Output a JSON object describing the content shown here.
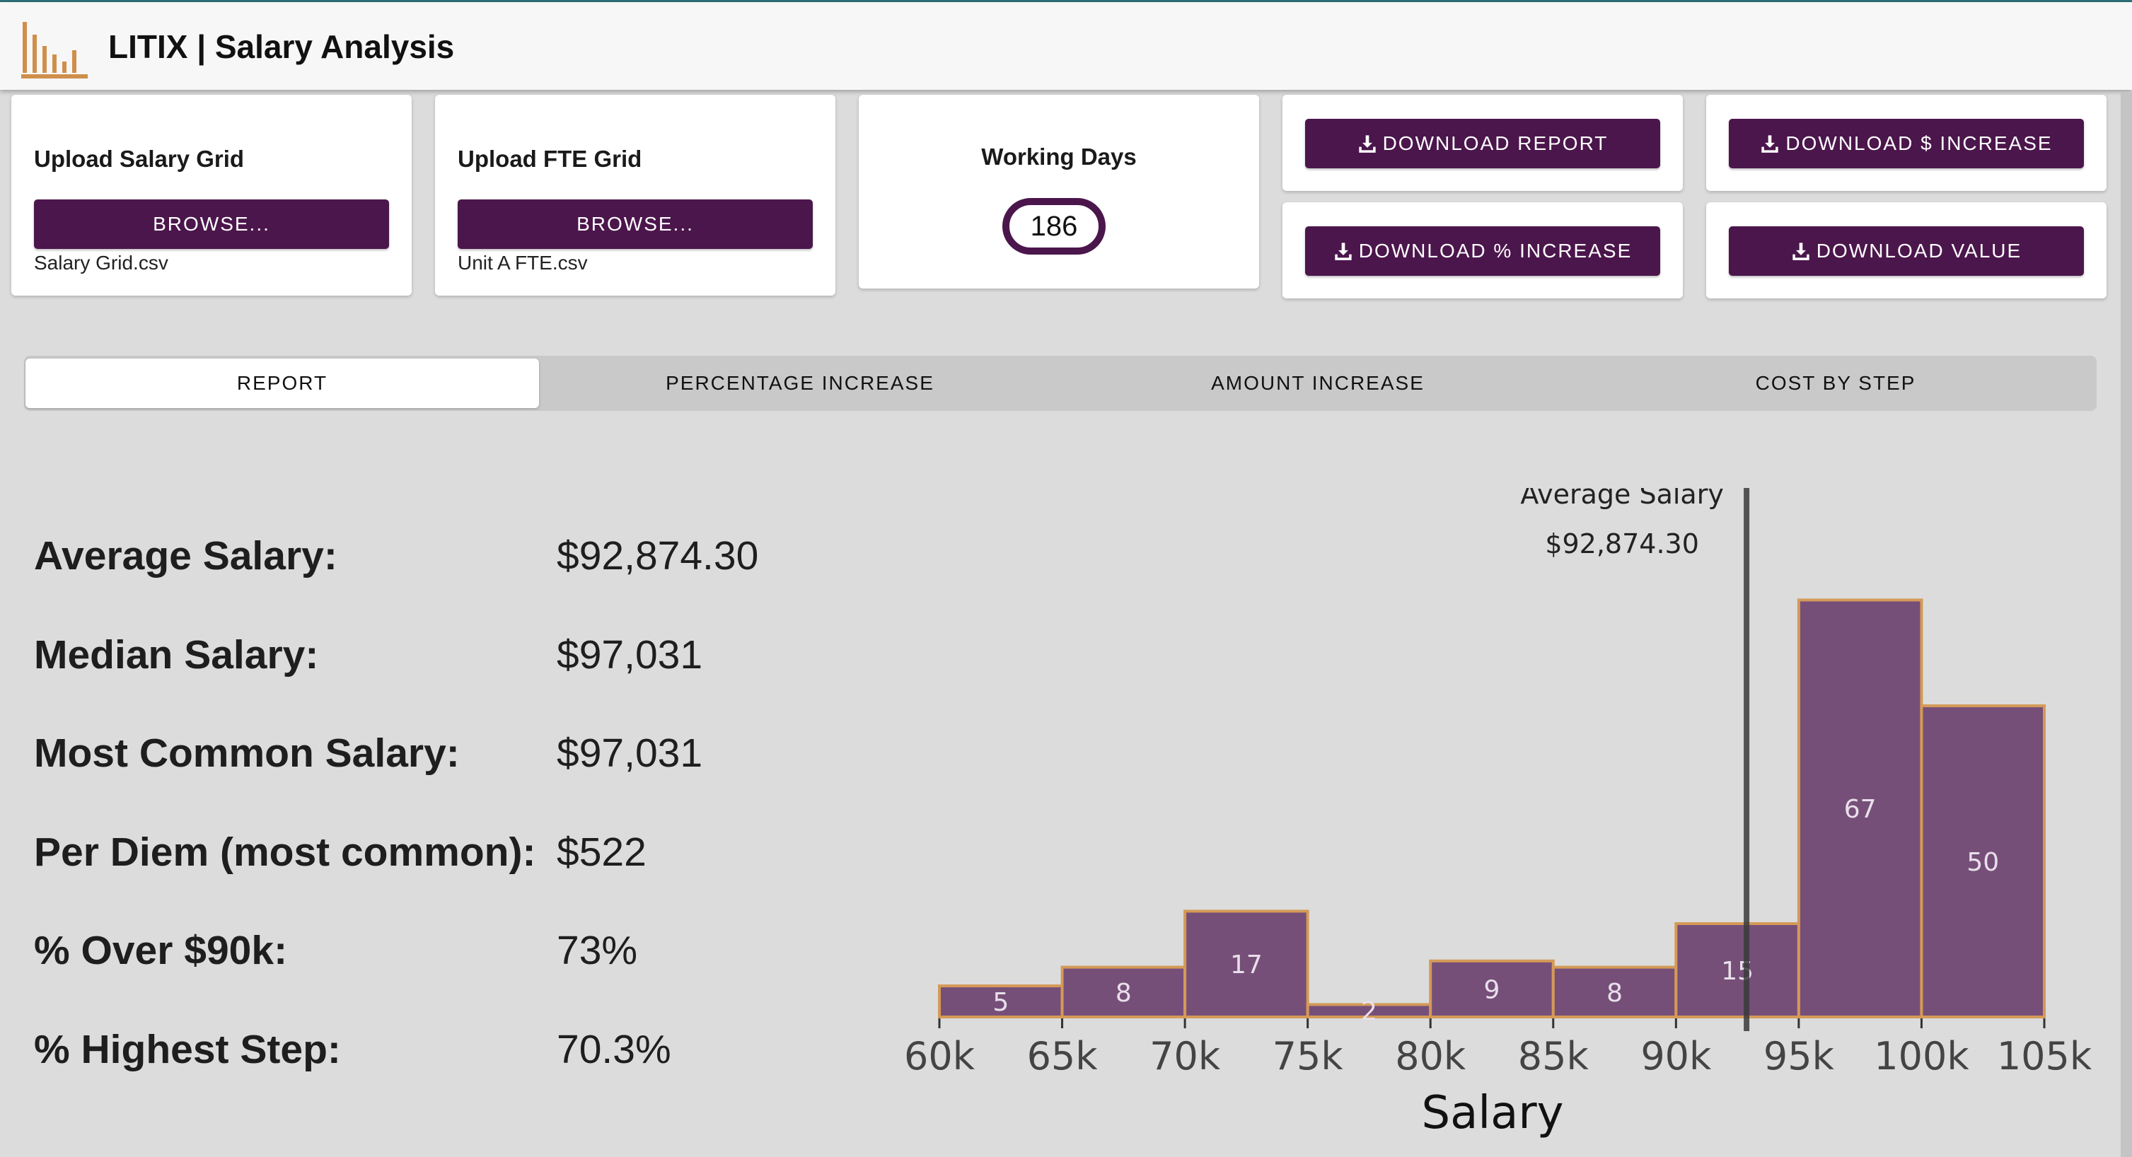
{
  "header": {
    "title": "LITIX | Salary Analysis",
    "logo_icon": "bar-chart-logo-icon"
  },
  "uploads": [
    {
      "title": "Upload Salary Grid",
      "button": "BROWSE...",
      "filename": "Salary Grid.csv"
    },
    {
      "title": "Upload FTE Grid",
      "button": "BROWSE...",
      "filename": "Unit A FTE.csv"
    }
  ],
  "working_days": {
    "title": "Working Days",
    "value": "186"
  },
  "downloads": {
    "report": "DOWNLOAD REPORT",
    "dollar_increase": "DOWNLOAD $ INCREASE",
    "percent_increase": "DOWNLOAD % INCREASE",
    "value": "DOWNLOAD VALUE",
    "icon": "download-icon"
  },
  "tabs": [
    {
      "label": "REPORT",
      "active": true
    },
    {
      "label": "PERCENTAGE INCREASE",
      "active": false
    },
    {
      "label": "AMOUNT INCREASE",
      "active": false
    },
    {
      "label": "COST BY STEP",
      "active": false
    }
  ],
  "stats": [
    {
      "label": "Average Salary:",
      "value": "$92,874.30"
    },
    {
      "label": "Median Salary:",
      "value": "$97,031"
    },
    {
      "label": "Most Common Salary:",
      "value": "$97,031"
    },
    {
      "label": "Per Diem (most common):",
      "value": "$522"
    },
    {
      "label": "% Over $90k:",
      "value": "73%"
    },
    {
      "label": "% Highest Step:",
      "value": "70.3%"
    }
  ],
  "colors": {
    "accent": "#4b164c",
    "bar_fill": "#764f79",
    "bar_edge": "#d49a57",
    "logo": "#cf8f4b"
  },
  "chart_data": {
    "type": "bar",
    "xlabel": "Salary",
    "ylabel": "",
    "bin_edges": [
      60000,
      65000,
      70000,
      75000,
      80000,
      85000,
      90000,
      95000,
      100000,
      105000
    ],
    "x_tick_labels": [
      "60k",
      "65k",
      "70k",
      "75k",
      "80k",
      "85k",
      "90k",
      "95k",
      "100k",
      "105k"
    ],
    "values": [
      5,
      8,
      17,
      2,
      9,
      8,
      15,
      67,
      50
    ],
    "mean_line": {
      "x": 92874.3,
      "label": "Average Salary",
      "value_label": "$92,874.30"
    },
    "grid": false,
    "legend": "none"
  }
}
